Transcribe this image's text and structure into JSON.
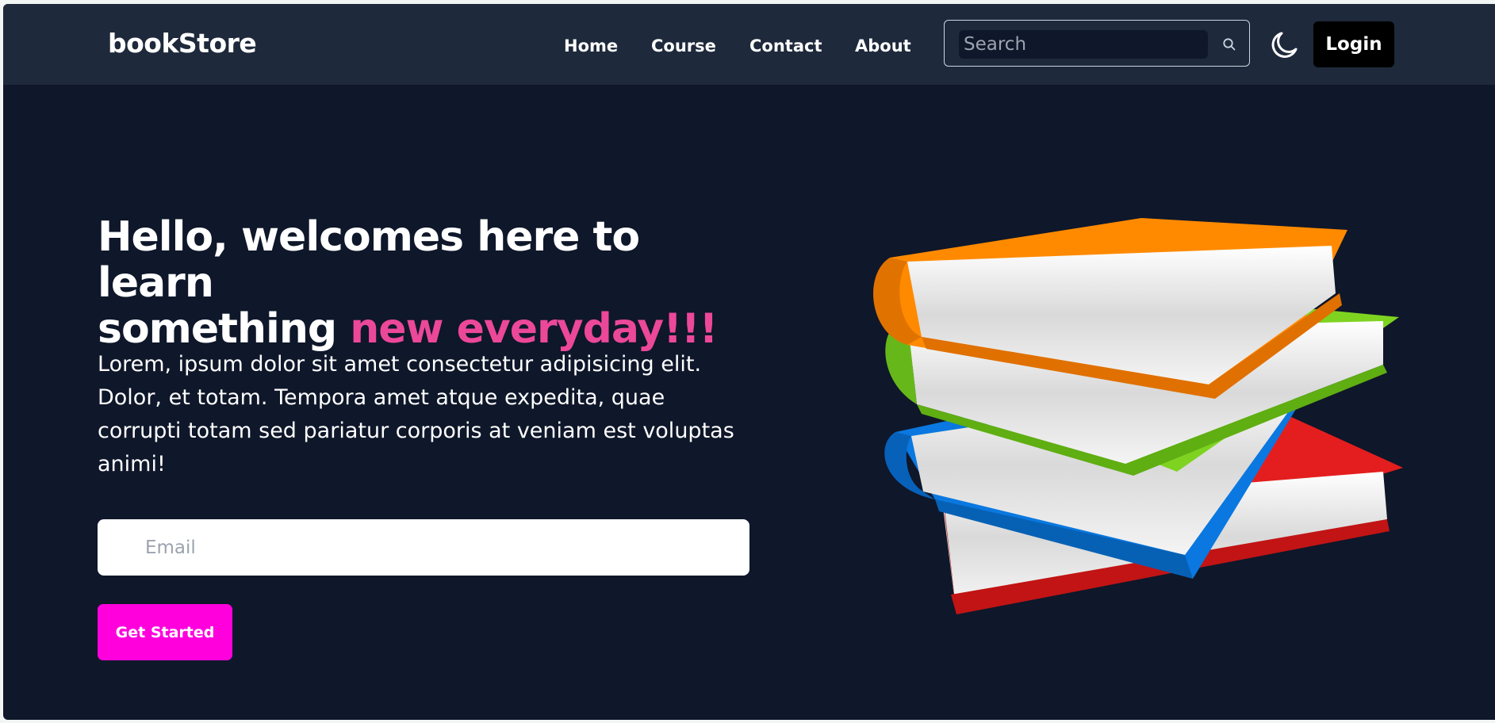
{
  "navbar": {
    "logo": "bookStore",
    "links": [
      "Home",
      "Course",
      "Contact",
      "About"
    ],
    "search_placeholder": "Search",
    "search_icon": "search-icon",
    "theme_icon": "moon-icon",
    "login_label": "Login"
  },
  "hero": {
    "title_line1": "Hello, welcomes here to learn",
    "title_line2_prefix": "something",
    "title_accent": "new everyday!!!",
    "description": "Lorem, ipsum dolor sit amet consectetur adipisicing elit. Dolor, et totam. Tempora amet atque expedita, quae corrupti totam sed pariatur corporis at veniam est voluptas animi!",
    "email_placeholder": "Email",
    "cta_label": "Get Started"
  },
  "colors": {
    "background": "#0f172a",
    "navbar": "#1e293b",
    "accent_text": "#ec4899",
    "cta": "#ff00dd",
    "book_orange": "#ff8a00",
    "book_green": "#7ed321",
    "book_blue": "#0a78e0",
    "book_red": "#e41e1e"
  }
}
